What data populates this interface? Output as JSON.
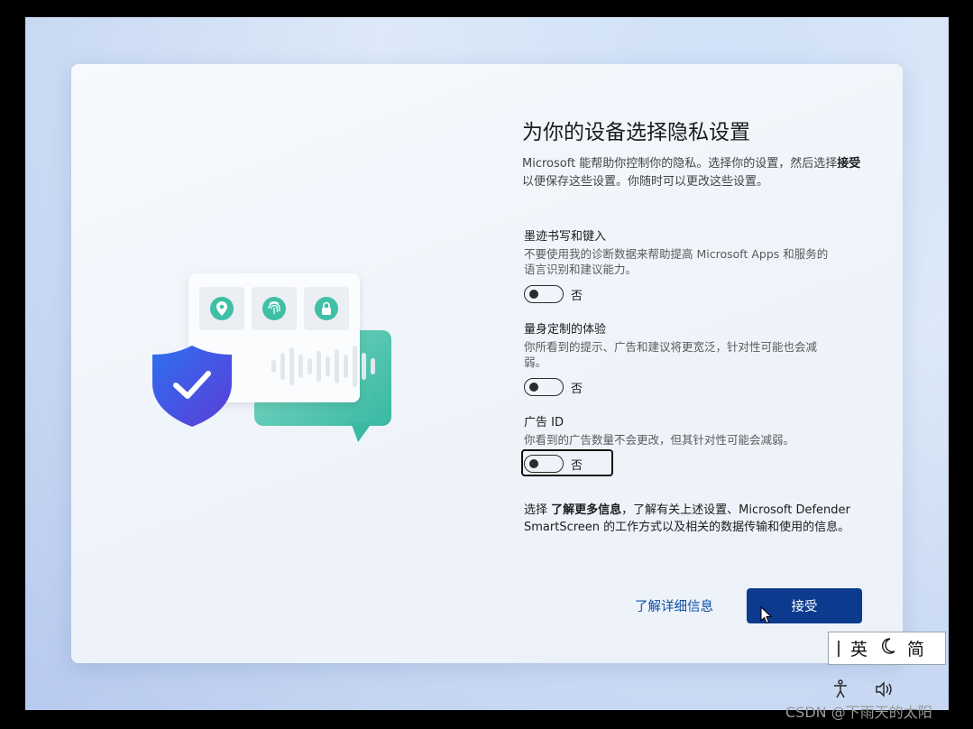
{
  "page": {
    "title": "为你的设备选择隐私设置",
    "description_prefix": "Microsoft 能帮助你控制你的隐私。选择你的设置，然后选择",
    "description_bold": "接受",
    "description_suffix": "以便保存这些设置。你随时可以更改这些设置。"
  },
  "settings": [
    {
      "title": "墨迹书写和键入",
      "description": "不要使用我的诊断数据来帮助提高 Microsoft Apps 和服务的语言识别和建议能力。",
      "toggle_label": "否",
      "enabled": false
    },
    {
      "title": "量身定制的体验",
      "description": "你所看到的提示、广告和建议将更宽泛，针对性可能也会减弱。",
      "toggle_label": "否",
      "enabled": false
    },
    {
      "title": "广告 ID",
      "description": "你看到的广告数量不会更改，但其针对性可能会减弱。",
      "toggle_label": "否",
      "enabled": false
    }
  ],
  "info": {
    "prefix": "选择 ",
    "bold": "了解更多信息",
    "suffix": "，了解有关上述设置、Microsoft Defender SmartScreen 的工作方式以及相关的数据传输和使用的信息。"
  },
  "buttons": {
    "learn_more": "了解详细信息",
    "accept": "接受"
  },
  "ime": {
    "language": "英",
    "mode": "简"
  },
  "colors": {
    "accent": "#0b3a8e",
    "link": "#0b4fa6",
    "shield": "#3a5fe0",
    "bubble": "#3cb9a2"
  },
  "watermark": "CSDN @下雨天的太阳"
}
